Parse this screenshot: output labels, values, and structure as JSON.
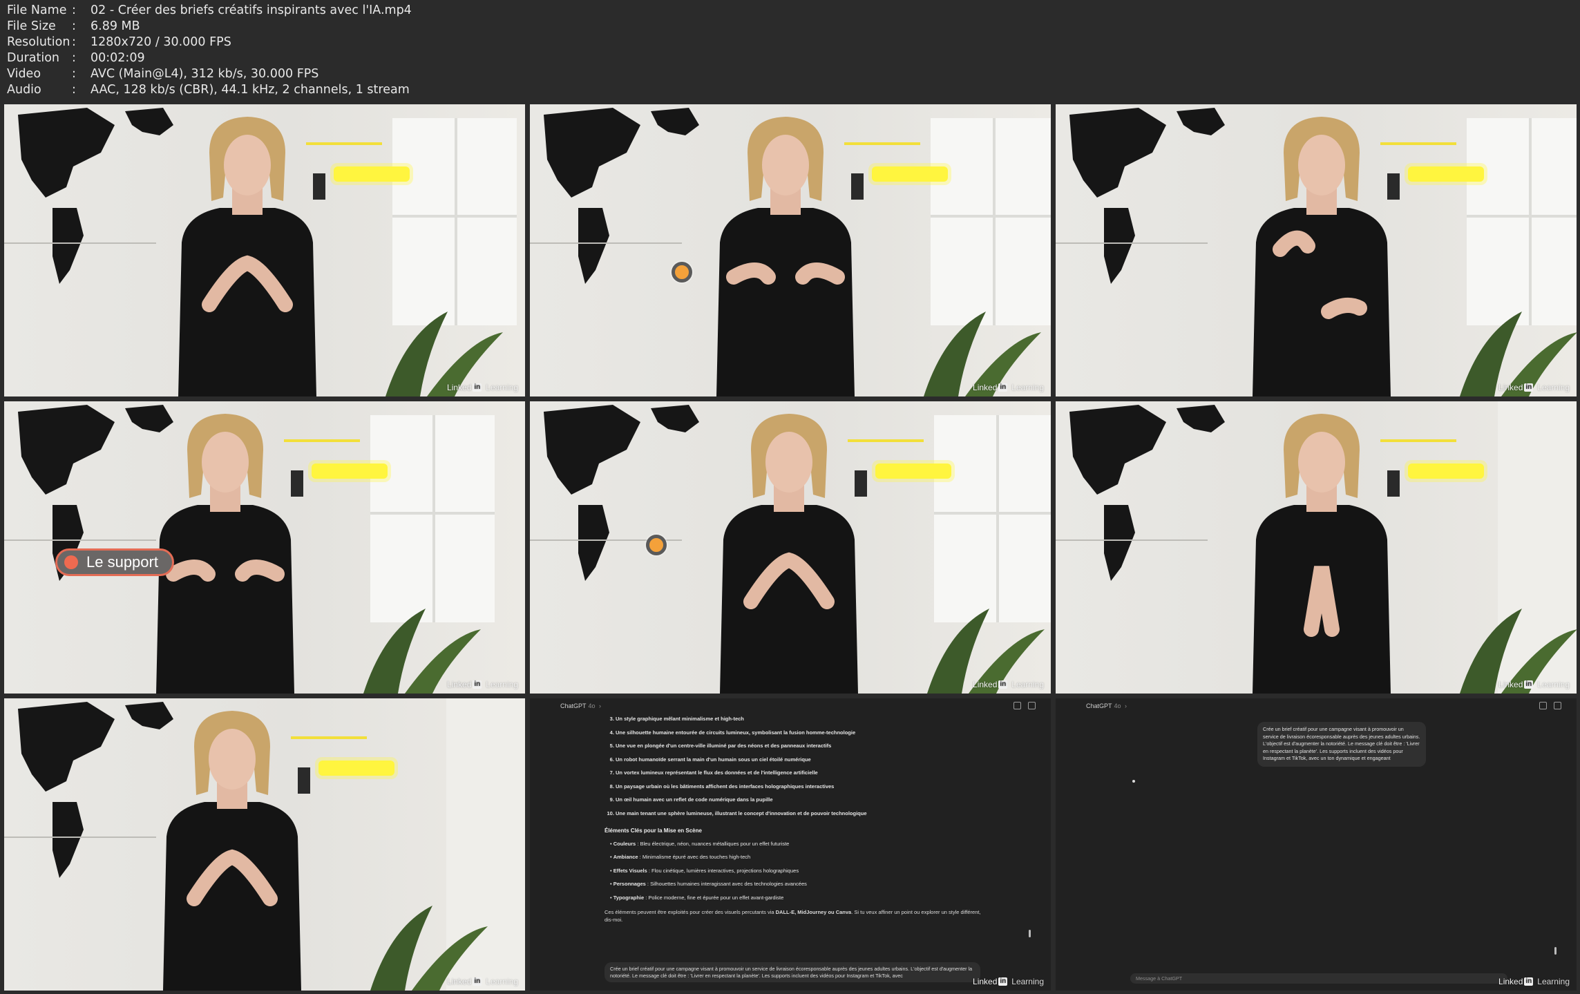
{
  "meta": [
    {
      "key": "File Name",
      "sep": ":",
      "value": "02 - Créer des briefs créatifs inspirants avec l'IA.mp4"
    },
    {
      "key": "File Size",
      "sep": ":",
      "value": "6.89 MB"
    },
    {
      "key": "Resolution",
      "sep": ":",
      "value": "1280x720 / 30.000 FPS"
    },
    {
      "key": "Duration",
      "sep": ":",
      "value": "00:02:09"
    },
    {
      "key": "Video",
      "sep": ":",
      "value": "AVC (Main@L4), 312 kb/s, 30.000 FPS"
    },
    {
      "key": "Audio",
      "sep": ":",
      "value": "AAC, 128 kb/s (CBR), 44.1 kHz, 2 channels, 1 stream"
    }
  ],
  "watermark": {
    "brand": "Linked",
    "in": "in",
    "learning": "Learning"
  },
  "lower_third": {
    "label": "Le support"
  },
  "chat1": {
    "title": "ChatGPT",
    "model": "4o",
    "list_start": 3,
    "items": [
      "Un style graphique mêlant minimalisme et high-tech",
      "Une silhouette humaine entourée de circuits lumineux, symbolisant la fusion homme-technologie",
      "Une vue en plongée d'un centre-ville illuminé par des néons et des panneaux interactifs",
      "Un robot humanoïde serrant la main d'un humain sous un ciel étoilé numérique",
      "Un vortex lumineux représentant le flux des données et de l'intelligence artificielle",
      "Un paysage urbain où les bâtiments affichent des interfaces holographiques interactives",
      "Un œil humain avec un reflet de code numérique dans la pupille",
      "Une main tenant une sphère lumineuse, illustrant le concept d'innovation et de pouvoir technologique"
    ],
    "section_title": "Éléments Clés pour la Mise en Scène",
    "bullets": [
      {
        "k": "Couleurs",
        "v": " : Bleu électrique, néon, nuances métalliques pour un effet futuriste"
      },
      {
        "k": "Ambiance",
        "v": " : Minimalisme épuré avec des touches high-tech"
      },
      {
        "k": "Effets Visuels",
        "v": " : Flou cinétique, lumières interactives, projections holographiques"
      },
      {
        "k": "Personnages",
        "v": " : Silhouettes humaines interagissant avec des technologies avancées"
      },
      {
        "k": "Typographie",
        "v": " : Police moderne, fine et épurée pour un effet avant-gardiste"
      }
    ],
    "closing_a": "Ces éléments peuvent être exploités pour créer des visuels percutants via ",
    "closing_tools": "DALL-E, MidJourney ou Canva",
    "closing_b": ". Si tu veux affiner un point ou explorer un style différent, dis-moi.",
    "composer_text": "Crée un brief créatif pour une campagne visant à promouvoir un service de livraison écoresponsable auprès des jeunes adultes urbains. L'objectif est d'augmenter la notoriété. Le message clé doit être : 'Livrer en respectant la planète'. Les supports incluent des vidéos pour Instagram et TikTok, avec"
  },
  "chat2": {
    "title": "ChatGPT",
    "model": "4o",
    "user_message": "Crée un brief créatif pour une campagne visant à promouvoir un service de livraison écoresponsable auprès des jeunes adultes urbains. L'objectif est d'augmenter la notoriété. Le message clé doit être : 'Livrer en respectant la planète'. Les supports incluent des vidéos pour Instagram et TikTok, avec un ton dynamique et engageant",
    "composer_placeholder": "Message à ChatGPT"
  },
  "colors": {
    "background": "#2b2b2b",
    "pill_border": "#e46c55",
    "pointer_dot": "#f4a13a",
    "chat_bg": "#212121"
  }
}
